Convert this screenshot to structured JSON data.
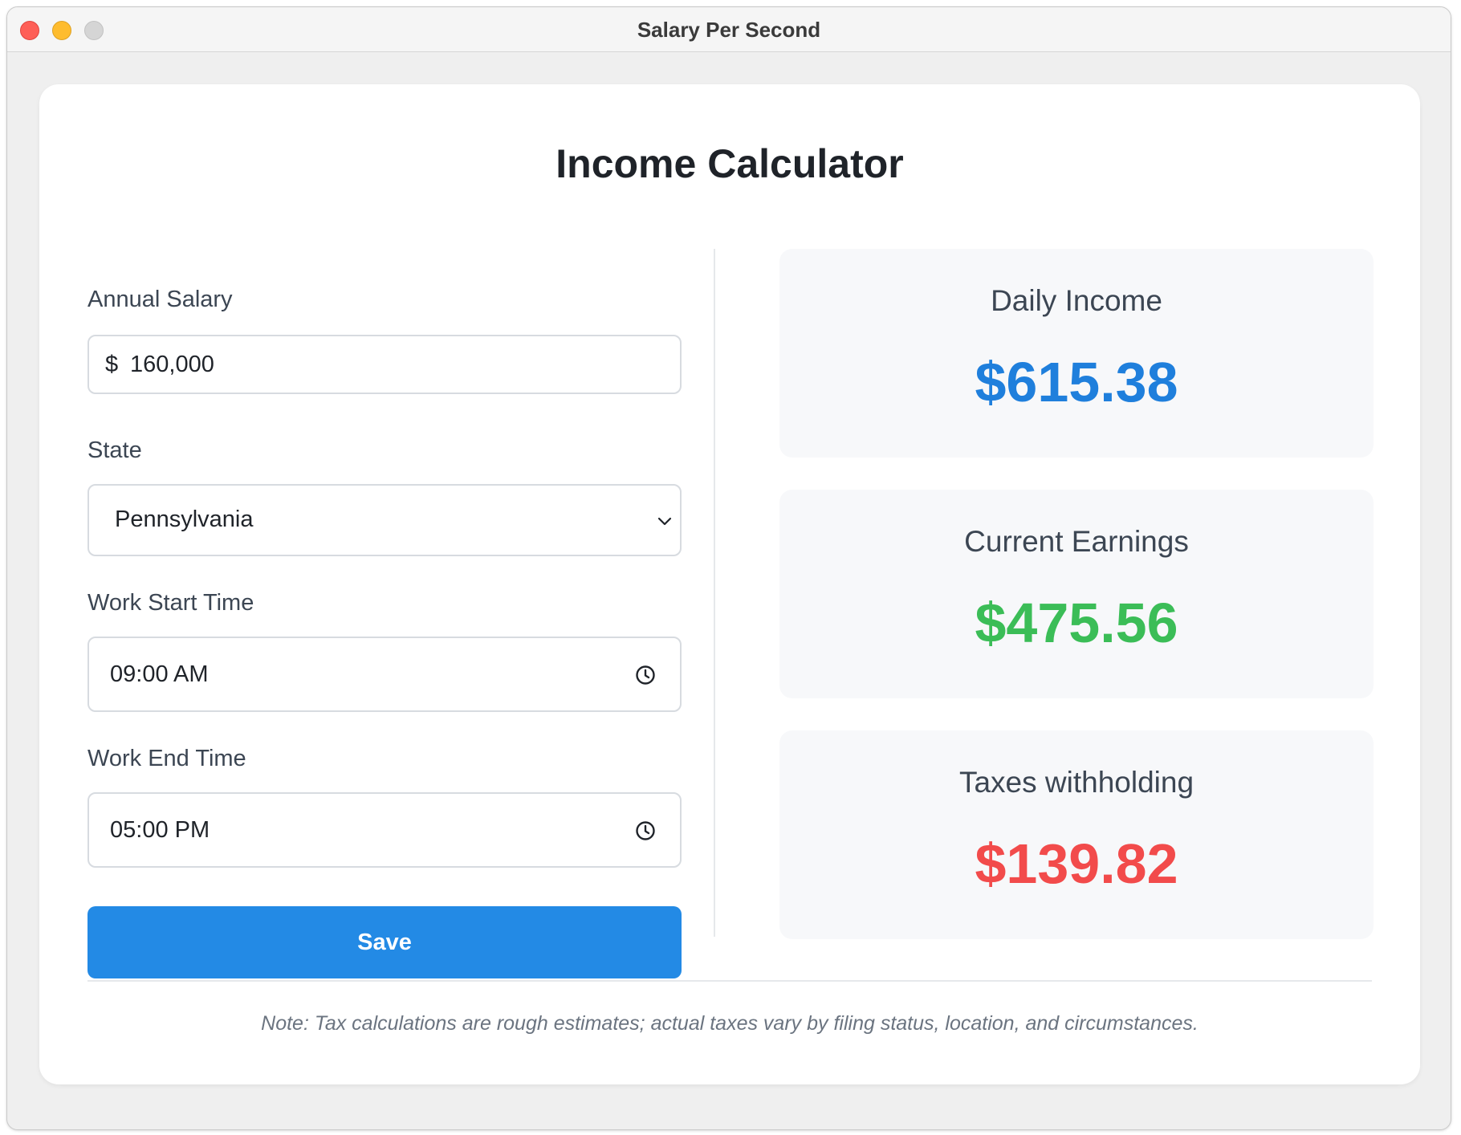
{
  "window": {
    "title": "Salary Per Second"
  },
  "page": {
    "title": "Income Calculator"
  },
  "form": {
    "salary": {
      "label": "Annual Salary",
      "prefix": "$",
      "value": "160,000"
    },
    "state": {
      "label": "State",
      "value": "Pennsylvania"
    },
    "start_time": {
      "label": "Work Start Time",
      "value": "09:00 AM"
    },
    "end_time": {
      "label": "Work End Time",
      "value": "05:00 PM"
    },
    "save_label": "Save"
  },
  "stats": {
    "daily_income": {
      "label": "Daily Income",
      "value": "$615.38",
      "color": "#1f7fdc"
    },
    "current_earnings": {
      "label": "Current Earnings",
      "value": "$475.56",
      "color": "#3bbd57"
    },
    "taxes": {
      "label": "Taxes withholding",
      "value": "$139.82",
      "color": "#f24b4b"
    }
  },
  "note": "Note: Tax calculations are rough estimates; actual taxes vary by filing status, location, and circumstances.",
  "colors": {
    "accent": "#238ae5"
  }
}
